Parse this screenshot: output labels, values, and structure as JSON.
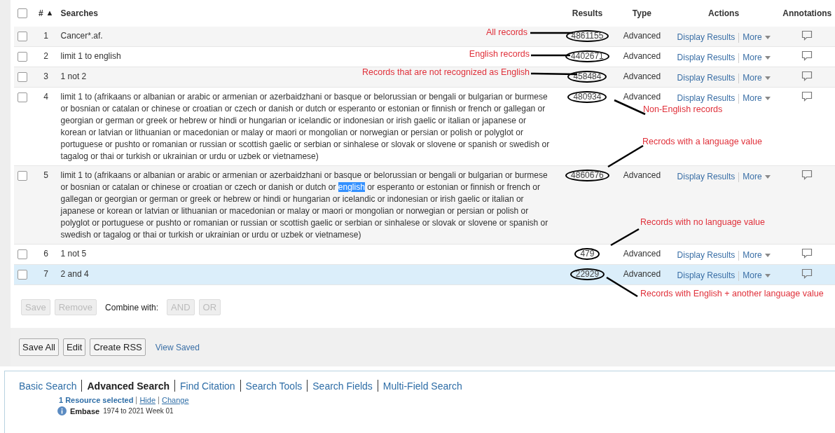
{
  "table": {
    "header_checkbox": {
      "checked": false
    },
    "columns": [
      "#",
      "Searches",
      "Results",
      "Type",
      "Actions",
      "Annotations"
    ],
    "sort_marker": "▲",
    "rows": [
      {
        "number": "1",
        "query": [
          {
            "text": "Cancer*.af.",
            "highlighted": false
          }
        ],
        "results": "4861155",
        "circled": true,
        "type": "Advanced",
        "action": "Display Results",
        "more": "More",
        "checked": false,
        "selected": false
      },
      {
        "number": "2",
        "query": [
          {
            "text": "limit 1 to english",
            "highlighted": false
          }
        ],
        "results": "4402671",
        "circled": true,
        "type": "Advanced",
        "action": "Display Results",
        "more": "More",
        "checked": false,
        "selected": false
      },
      {
        "number": "3",
        "query": [
          {
            "text": "1 not 2",
            "highlighted": false
          }
        ],
        "results": "458484",
        "circled": true,
        "type": "Advanced",
        "action": "Display Results",
        "more": "More",
        "checked": false,
        "selected": false
      },
      {
        "number": "4",
        "query": [
          {
            "text": "limit 1 to (afrikaans or albanian or arabic or armenian or azerbaidzhani or basque or belorussian or bengali or bulgarian or burmese or bosnian or catalan or chinese or croatian or czech or danish or dutch or esperanto or estonian or finnish or french or gallegan or georgian or german or greek or hebrew or hindi or hungarian or icelandic or indonesian or irish gaelic or italian or japanese or korean or latvian or lithuanian or macedonian or malay or maori or mongolian or norwegian or persian or polish or polyglot or portuguese or pushto or romanian or russian or scottish gaelic or serbian or sinhalese or slovak or slovene or spanish or swedish or tagalog or thai or turkish or ukrainian or urdu or uzbek or vietnamese)",
            "highlighted": false
          }
        ],
        "results": "480934",
        "circled": true,
        "type": "Advanced",
        "action": "Display Results",
        "more": "More",
        "checked": false,
        "selected": false
      },
      {
        "number": "5",
        "query": [
          {
            "text": "limit 1 to (afrikaans or albanian or arabic or armenian or azerbaidzhani or basque or belorussian or bengali or bulgarian or burmese or bosnian or catalan or chinese or croatian or czech or danish or dutch or",
            "highlighted": false
          },
          {
            "text": "english",
            "highlighted": true
          },
          {
            "text": "or esperanto or estonian or finnish or french or gallegan or georgian or german or greek or hebrew or hindi or hungarian or icelandic or indonesian or irish gaelic or italian or japanese or korean or latvian or lithuanian or macedonian or malay or maori or mongolian or norwegian or persian or polish or polyglot or portuguese or pushto or romanian or russian or scottish gaelic or serbian or sinhalese or slovak or slovene or spanish or swedish or tagalog or thai or turkish or ukrainian or urdu or uzbek or vietnamese)",
            "highlighted": false
          }
        ],
        "results": "4860676",
        "circled": true,
        "type": "Advanced",
        "action": "Display Results",
        "more": "More",
        "checked": false,
        "selected": false
      },
      {
        "number": "6",
        "query": [
          {
            "text": "1 not 5",
            "highlighted": false
          }
        ],
        "results": "479",
        "circled": true,
        "type": "Advanced",
        "action": "Display Results",
        "more": "More",
        "checked": false,
        "selected": false
      },
      {
        "number": "7",
        "query": [
          {
            "text": "2 and 4",
            "highlighted": false
          }
        ],
        "results": "22929",
        "circled": true,
        "type": "Advanced",
        "action": "Display Results",
        "more": "More",
        "checked": false,
        "selected": true
      }
    ]
  },
  "row_controls": [
    {
      "label": "Save",
      "disabled": true
    },
    {
      "label": "Remove",
      "disabled": true
    },
    {
      "label": "Combine with:",
      "kind": "label"
    },
    {
      "label": "AND",
      "disabled": true
    },
    {
      "label": "OR",
      "disabled": true
    }
  ],
  "history_buttons": [
    {
      "label": "Save All",
      "kind": "button"
    },
    {
      "label": "Edit",
      "kind": "button"
    },
    {
      "label": "Create RSS",
      "kind": "button"
    },
    {
      "label": "View Saved",
      "kind": "link"
    }
  ],
  "callouts": [
    "All records",
    "English records",
    "Records that are not recognized as English",
    "Non-English records",
    "Recrods with a language value",
    "Records with no language value",
    "Records with English + another language  value"
  ],
  "search_tabs": [
    {
      "label": "Basic Search",
      "selected": false
    },
    {
      "label": "Advanced Search",
      "selected": true
    },
    {
      "label": "Find Citation",
      "selected": false
    },
    {
      "label": "Search Tools",
      "selected": false
    },
    {
      "label": "Search Fields",
      "selected": false
    },
    {
      "label": "Multi-Field Search",
      "selected": false
    }
  ],
  "resources": {
    "summary": "1 Resource selected",
    "links": [
      "Hide",
      "Change"
    ],
    "database": "Embase",
    "coverage": "1974 to 2021 Week 01"
  }
}
